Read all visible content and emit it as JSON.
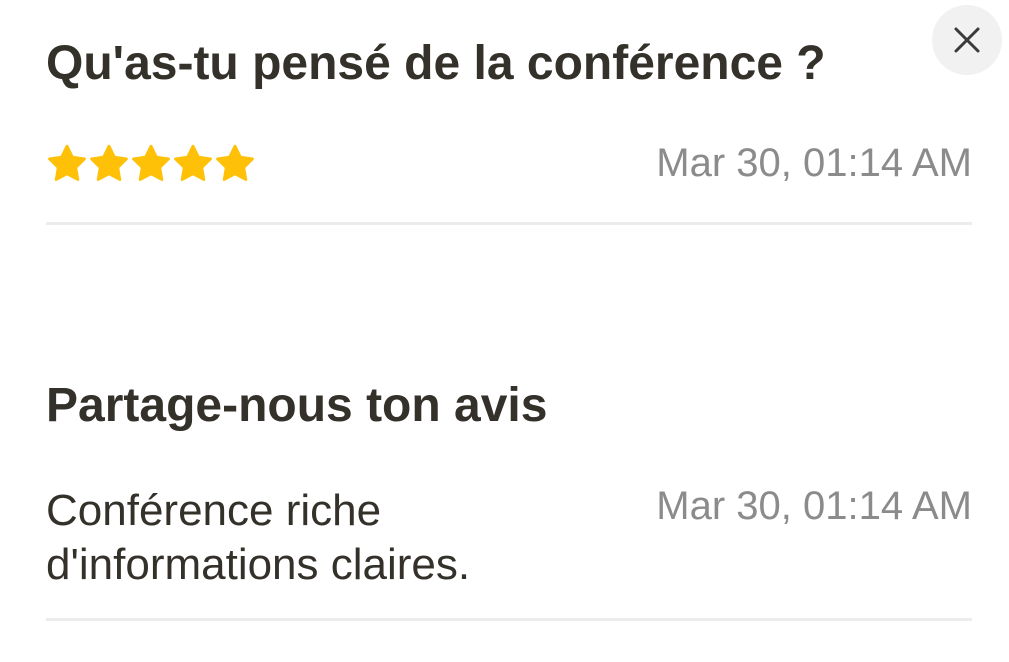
{
  "question": {
    "title": "Qu'as-tu pensé de la conférence ?",
    "rating": 5,
    "rating_max": 5,
    "star_color": "#ffc107",
    "date": "Mar 30, 01:14 AM"
  },
  "feedback": {
    "title": "Partage-nous ton avis",
    "text": "Conférence riche d'informations claires.",
    "date": "Mar 30, 01:14 AM"
  },
  "close_button": {
    "icon": "close-icon"
  }
}
